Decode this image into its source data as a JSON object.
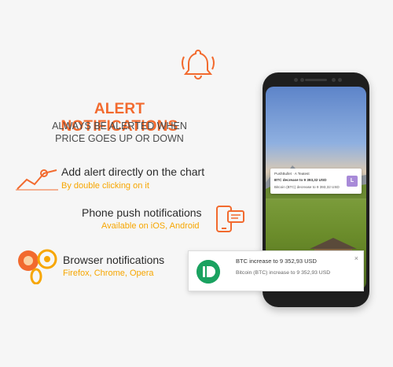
{
  "header": {
    "title": "ALERT NOTIFICATIONS",
    "subtitle_line1": "ALWAYS BE ALERTED WHEN",
    "subtitle_line2": "PRICE GOES UP OR DOWN"
  },
  "features": [
    {
      "title": "Add alert directly on the chart",
      "subtitle": "By double clicking on it",
      "icon": "chart-alert-icon"
    },
    {
      "title": "Phone push notifications",
      "subtitle": "Available on iOS, Android",
      "icon": "phone-notification-icon"
    },
    {
      "title": "Browser notifications",
      "subtitle": "Firefox, Chrome, Opera",
      "icon": "browser-logos-icon"
    }
  ],
  "phone_notification": {
    "app": "PushBullet · A Teatest",
    "title": "BTC decrease to 9 393,32 USD",
    "body": "Bitcoin (BTC) decrease to 9 393,32 USD",
    "badge": "L"
  },
  "desktop_notification": {
    "title": "BTC increase to 9 352,93 USD",
    "body": "Bitcoin (BTC) increase to 9 352,93 USD",
    "close": "×"
  },
  "colors": {
    "accent_orange": "#f26a2e",
    "accent_yellow": "#f7a600",
    "pushbullet_green": "#1aa260"
  }
}
